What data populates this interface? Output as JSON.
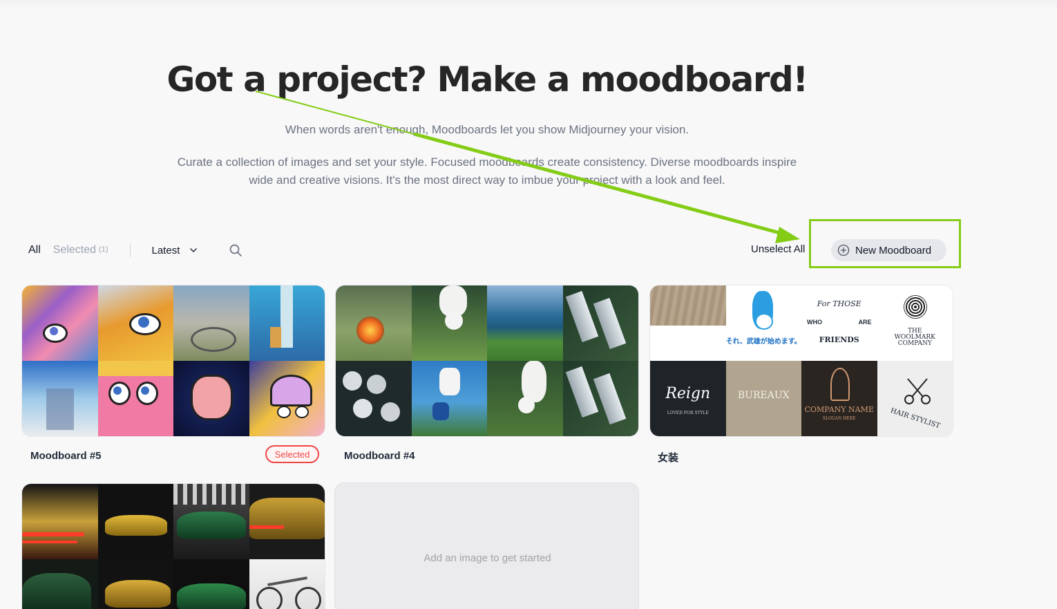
{
  "hero": {
    "title": "Got a project? Make a moodboard!",
    "subtitle": "When words aren't enough, Moodboards let you show Midjourney your vision.",
    "description": "Curate a collection of images and set your style. Focused moodboards create consistency. Diverse moodboards inspire wide and creative visions. It's the most direct way to imbue your project with a look and feel."
  },
  "filters": {
    "all_label": "All",
    "selected_label": "Selected",
    "selected_count": "(1)",
    "sort_label": "Latest",
    "search_icon": "search-icon",
    "chevron_icon": "chevron-down-icon"
  },
  "actions": {
    "unselect_label": "Unselect All",
    "new_moodboard_label": "New Moodboard",
    "new_icon": "plus-circle-icon"
  },
  "annotation": {
    "arrow_color": "#84cc16",
    "box_color": "#84cc16"
  },
  "moodboards": [
    {
      "name": "Moodboard #5",
      "selected": true,
      "badge": "Selected"
    },
    {
      "name": "Moodboard #4",
      "selected": false
    },
    {
      "name": "女装",
      "selected": false,
      "logos": [
        "For THOSE",
        "WHO",
        "ARE",
        "FRIENDS",
        "THE WOOLMARK COMPANY",
        "それ、武雄が始めます。",
        "Reign",
        "LOVED FOR STYLE",
        "BUREAUX",
        "COMPANY NAME",
        "SLOGAN HERE",
        "HAIR STYLIST"
      ]
    },
    {
      "name": "",
      "selected": false
    },
    {
      "name": "",
      "empty": true,
      "empty_text": "Add an image to get started"
    }
  ],
  "colors": {
    "accent_selected": "#ef4444",
    "highlight": "#84cc16"
  }
}
